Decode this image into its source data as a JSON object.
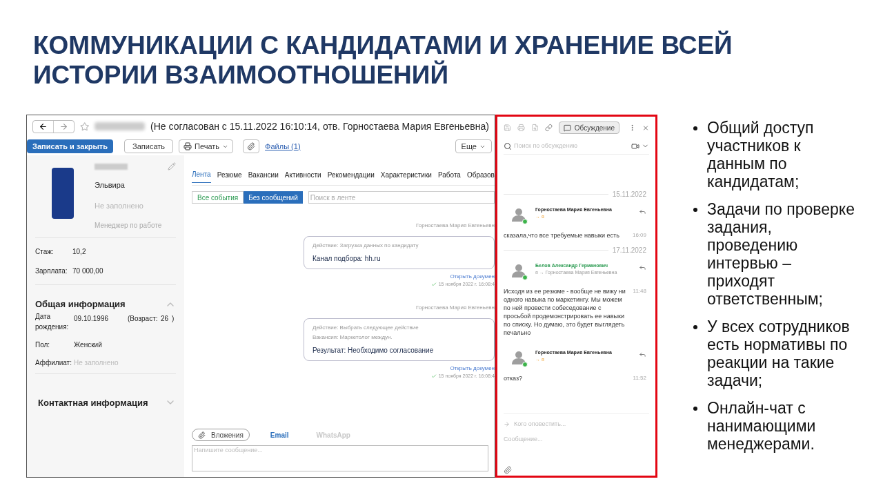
{
  "slide": {
    "title": "КОММУНИКАЦИИ С КАНДИДАТАМИ И ХРАНЕНИЕ ВСЕЙ ИСТОРИИ ВЗАИМООТНОШЕНИЙ"
  },
  "app": {
    "title": "(Не согласован с 15.11.2022 16:10:14, отв. Горностаева Мария Евгеньевна)",
    "toolbar": [
      {
        "label": "Записать и закрыть",
        "kind": "primary"
      },
      {
        "label": "Записать",
        "kind": "plain"
      },
      {
        "label": "Печать",
        "kind": "menu"
      }
    ],
    "files_link": "Файлы (1)",
    "more": "Еще",
    "profile": {
      "first_name": "Эльвира",
      "fields": [
        "Не заполнено",
        "Менеджер по работе"
      ]
    },
    "stats": [
      {
        "label": "Стаж:",
        "value": "10,2"
      },
      {
        "label": "Зарплата:",
        "value": "70 000,00"
      }
    ],
    "general_info": {
      "title": "Общая информация",
      "expanded": true,
      "birth_label": "Дата рождения:",
      "birth_date": "09.10.1996",
      "age_label": "(Возраст:",
      "age": "26",
      "age_close": ")",
      "fields": [
        {
          "label": "Пол:",
          "value": "Женский",
          "empty": false
        },
        {
          "label": "Аффилиат:",
          "value": "Не заполнено",
          "empty": true
        }
      ]
    },
    "contact_info": {
      "title": "Контактная информация",
      "expanded": false
    },
    "tabs": [
      {
        "label": "Лента",
        "selected": true
      },
      {
        "label": "Резюме",
        "selected": false
      },
      {
        "label": "Вакансии",
        "selected": false
      },
      {
        "label": "Активности",
        "selected": false
      },
      {
        "label": "Рекомендации",
        "selected": false
      },
      {
        "label": "Характеристики",
        "selected": false
      },
      {
        "label": "Работа",
        "selected": false
      },
      {
        "label": "Образов",
        "selected": false
      }
    ],
    "filters": [
      {
        "label": "Все события",
        "selected": false
      },
      {
        "label": "Без сообщений",
        "selected": true
      }
    ],
    "feed_search": {
      "placeholder": "Поиск в ленте"
    },
    "events": [
      {
        "author": "Горностаева Мария Евгеньевн",
        "details": [
          "Действие: Загрузка данных по кандидату"
        ],
        "result": "Канал подбора: hh.ru",
        "link": "Открыть докумен",
        "time": "15 ноября 2022 г. 16:08:4"
      },
      {
        "author": "Горностаева Мария Евгеньевн",
        "details": [
          "Действие: Выбрать следующее действие",
          "Вакансия: Маркетолог междун."
        ],
        "result": "Результат: Необходимо согласование",
        "link": "Открыть докумен",
        "time": "15 ноября 2022 г. 16:08:4"
      }
    ],
    "composer": {
      "attach": "Вложения",
      "channels": [
        {
          "label": "Email",
          "selected": true
        },
        {
          "label": "WhatsApp",
          "selected": false
        }
      ],
      "placeholder": "Напишите сообщение..."
    }
  },
  "chat": {
    "discussion_button": "Обсуждение",
    "search": {
      "placeholder": "Поиск по обсуждению"
    },
    "groups": [
      {
        "date": "15.11.2022",
        "messages": [
          {
            "author": "Горностаева Мария Евгеньевна",
            "highlighted": false,
            "online": true,
            "recipients": "→ я",
            "to_me": true,
            "text": "сказала,что все требуемые навыки есть",
            "time": "16:09"
          }
        ]
      },
      {
        "date": "17.11.2022",
        "messages": [
          {
            "author": "Белов Александр Германович",
            "highlighted": true,
            "online": true,
            "recipients": "я → Горностаева Мария Евгеньевна",
            "to_me": false,
            "text": "Исходя из ее резюме - вообще не вижу ни одного навыка по маркетингу. Мы можем по ней провести собеседование с просьбой продемонстрировать ее навыки по списку. Но думаю, это будет выглядеть печально",
            "time": "11:48"
          },
          {
            "author": "Горностаева Мария Евгеньевна",
            "highlighted": false,
            "online": true,
            "recipients": "→ я",
            "to_me": true,
            "text": "отказ?",
            "time": "11:52"
          }
        ]
      }
    ],
    "notify": {
      "placeholder": "Кого оповестить..."
    },
    "message": {
      "placeholder": "Сообщение..."
    }
  },
  "bullets": [
    "Общий доступ участников к данным по кандидатам;",
    "Задачи по проверке задания, проведению интервью – приходят ответственным;",
    "У всех сотрудников есть нормативы по реакции на такие задачи;",
    "Онлайн-чат с нанимающими менеджерами."
  ]
}
